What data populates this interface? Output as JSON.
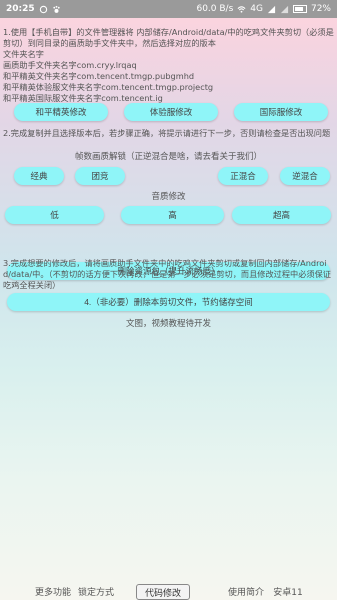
{
  "status": {
    "time": "20:25",
    "speed": "60.0 B/s",
    "network": "4G",
    "battery": "72%"
  },
  "instructions": {
    "p1": "1.使用【手机自带】的文件管理器将 内部储存/Android/data/中的吃鸡文件夹剪切（必须是剪切）到同目录的画质助手文件夹中，然后选择对应的版本",
    "label_folder": "文件夹名字",
    "assistant_folder": "画质助手文件夹名字com.cryy.lrqaq",
    "elite_folder": "和平精英文件夹名字com.tencent.tmgp.pubgmhd",
    "experience_folder": "和平精英体验服文件夹名字com.tencent.tmgp.projectg",
    "international_folder": "和平精英国际服文件夹名字com.tencent.ig",
    "p2": "2.完成复制并且选择版本后，若步骤正确，将提示请进行下一步，否则请检查是否出现问题",
    "p3": "3.完成想要的修改后，请将画质助手文件夹中的吃鸡文件夹剪切或复制回内部储存/Android/data/中。（不剪切的话方便下次再改，但是第一步必须是剪切，而且修改过程中必须保证吃鸡全程关闭）",
    "footer_note": "文图，视频教程待开发"
  },
  "version_buttons": {
    "elite": "和平精英修改",
    "experience": "体验服修改",
    "international": "国际服修改"
  },
  "frame_section": {
    "title": "帧数画质解锁（正逆混合是啥，请去看关于我们）",
    "classic": "经典",
    "team": "团竞",
    "forward_mix": "正混合",
    "reverse_mix": "逆混合"
  },
  "audio_section": {
    "title": "音质修改",
    "low": "低",
    "high": "高",
    "ultra": "超高"
  },
  "delete_resource": "删除资源包（提升流畅度）",
  "step4": "4.（非必要）删除本剪切文件，节约储存空间",
  "bottom_nav": {
    "more": "更多功能",
    "lock": "锁定方式",
    "code_mod": "代码修改",
    "intro": "使用简介",
    "android": "安卓11"
  }
}
